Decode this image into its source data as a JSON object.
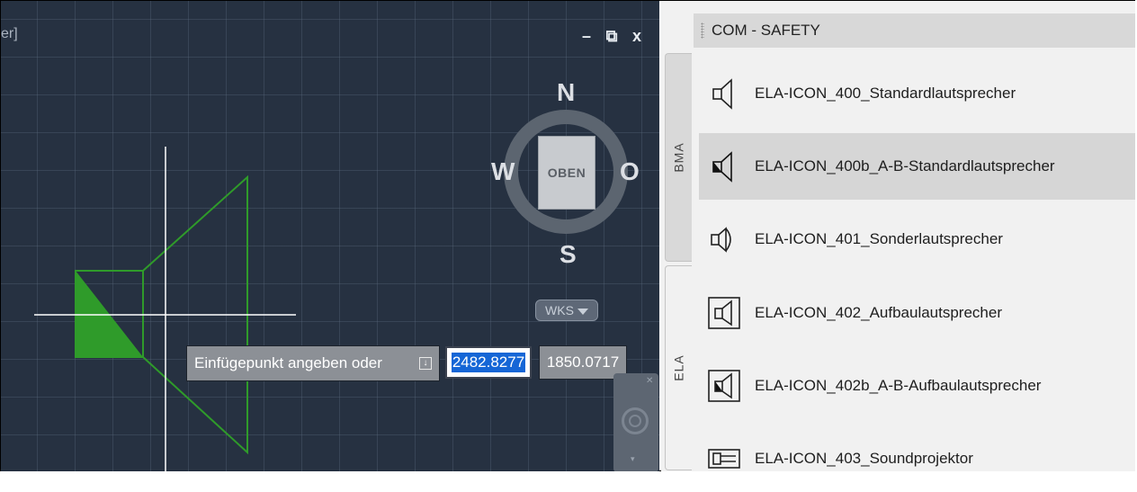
{
  "cad": {
    "view_label": "er]",
    "window_controls": {
      "minimize": "–",
      "restore": "⧉",
      "close": "x"
    },
    "viewcube": {
      "north": "N",
      "south": "S",
      "east": "O",
      "west": "W",
      "face": "OBEN",
      "ucs": "WKS"
    },
    "dynamic_input": {
      "prompt": "Einfügepunkt angeben oder",
      "options_icon": "arrow-down-icon",
      "x_value": "2482.8277",
      "y_value": "1850.0717"
    },
    "colors": {
      "background": "#263141",
      "entity": "#2f9b2a",
      "crosshair": "#ffffff"
    }
  },
  "palette": {
    "title": "COM - SAFETY",
    "tabs": [
      {
        "label": "BMA"
      },
      {
        "label": "ELA"
      }
    ],
    "items": [
      {
        "label": "ELA-ICON_400_Standardlautsprecher",
        "icon": "speaker-icon",
        "selected": false
      },
      {
        "label": "ELA-ICON_400b_A-B-Standardlautsprecher",
        "icon": "speaker-ab-icon",
        "selected": true
      },
      {
        "label": "ELA-ICON_401_Sonderlautsprecher",
        "icon": "special-speaker-icon",
        "selected": false
      },
      {
        "label": "ELA-ICON_402_Aufbaulautsprecher",
        "icon": "surface-speaker-icon",
        "selected": false
      },
      {
        "label": "ELA-ICON_402b_A-B-Aufbaulautsprecher",
        "icon": "surface-speaker-ab-icon",
        "selected": false
      },
      {
        "label": "ELA-ICON_403_Soundprojektor",
        "icon": "sound-projector-icon",
        "selected": false
      }
    ]
  }
}
